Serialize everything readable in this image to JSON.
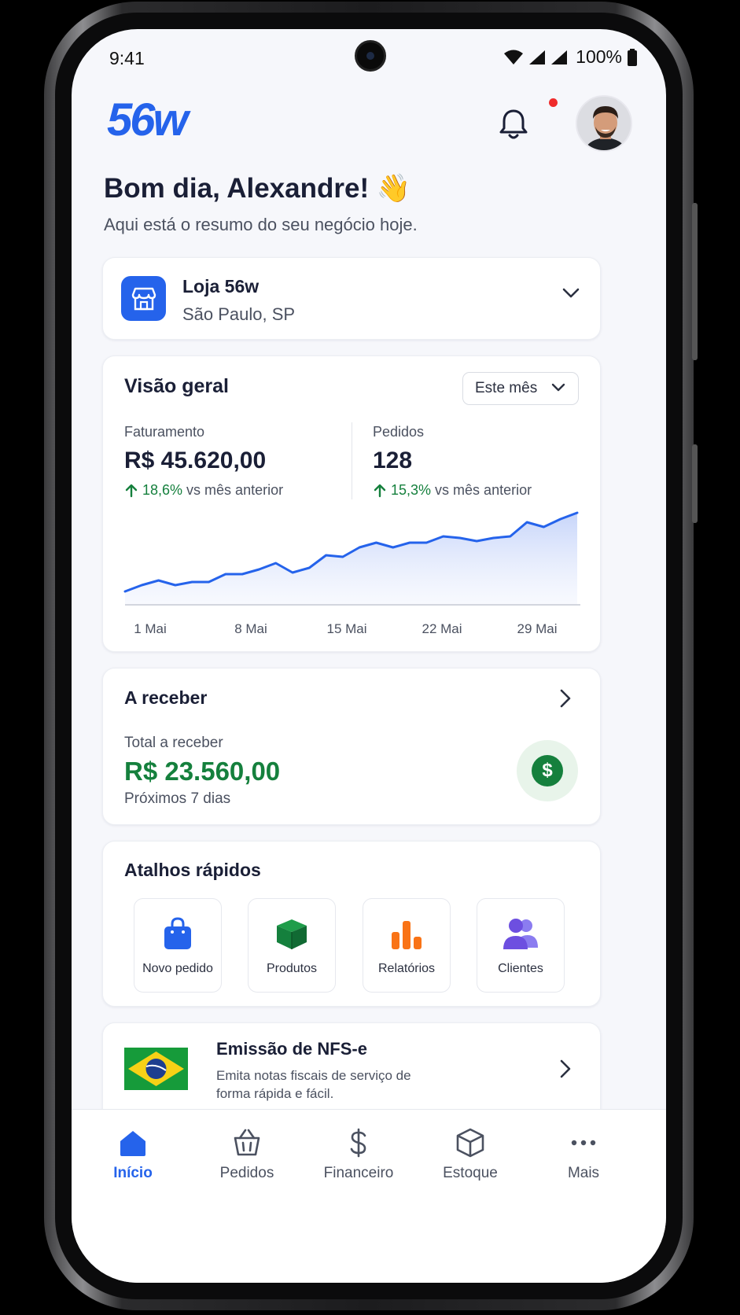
{
  "status_bar": {
    "time": "9:41",
    "battery": "100%"
  },
  "header": {
    "logo": "56w"
  },
  "greeting": {
    "title": "Bom dia, Alexandre! 👋",
    "subtitle": "Aqui está o resumo do seu negócio hoje."
  },
  "store": {
    "name": "Loja 56w",
    "location": "São Paulo, SP"
  },
  "overview": {
    "title": "Visão geral",
    "period": "Este mês",
    "revenue": {
      "label": "Faturamento",
      "value": "R$ 45.620,00",
      "delta": "18,6%",
      "delta_suffix": "vs mês anterior"
    },
    "orders": {
      "label": "Pedidos",
      "value": "128",
      "delta": "15,3%",
      "delta_suffix": "vs mês anterior"
    }
  },
  "chart_data": {
    "type": "area",
    "x_tick_labels": [
      "1 Mai",
      "8 Mai",
      "15 Mai",
      "22 Mai",
      "29 Mai"
    ],
    "values": [
      8,
      12,
      15,
      12,
      14,
      14,
      19,
      19,
      22,
      26,
      20,
      23,
      31,
      30,
      36,
      39,
      36,
      39,
      39,
      43,
      42,
      40,
      42,
      43,
      52,
      49,
      54,
      58
    ],
    "line_color": "#2563eb",
    "fill_color": "#e6ecfc",
    "ylim": [
      0,
      60
    ]
  },
  "receivable": {
    "title": "A receber",
    "label": "Total a receber",
    "value": "R$ 23.560,00",
    "sub": "Próximos 7 dias"
  },
  "shortcuts": {
    "title": "Atalhos rápidos",
    "items": [
      {
        "label": "Novo pedido",
        "icon": "shopping-bag-icon",
        "color": "#2563eb"
      },
      {
        "label": "Produtos",
        "icon": "box-icon",
        "color": "#15803d"
      },
      {
        "label": "Relatórios",
        "icon": "bar-chart-icon",
        "color": "#f97316"
      },
      {
        "label": "Clientes",
        "icon": "users-icon",
        "color": "#6d4fe0"
      }
    ]
  },
  "nfse": {
    "title": "Emissão de NFS-e",
    "subtitle": "Emita notas fiscais de serviço de forma rápida e fácil."
  },
  "bottom_nav": {
    "items": [
      {
        "label": "Início",
        "icon": "home-icon",
        "active": true
      },
      {
        "label": "Pedidos",
        "icon": "basket-icon",
        "active": false
      },
      {
        "label": "Financeiro",
        "icon": "dollar-icon",
        "active": false
      },
      {
        "label": "Estoque",
        "icon": "cube-icon",
        "active": false
      },
      {
        "label": "Mais",
        "icon": "more-icon",
        "active": false
      }
    ]
  },
  "colors": {
    "accent": "#2563eb",
    "positive": "#15803d",
    "notification": "#ef2b2b"
  }
}
